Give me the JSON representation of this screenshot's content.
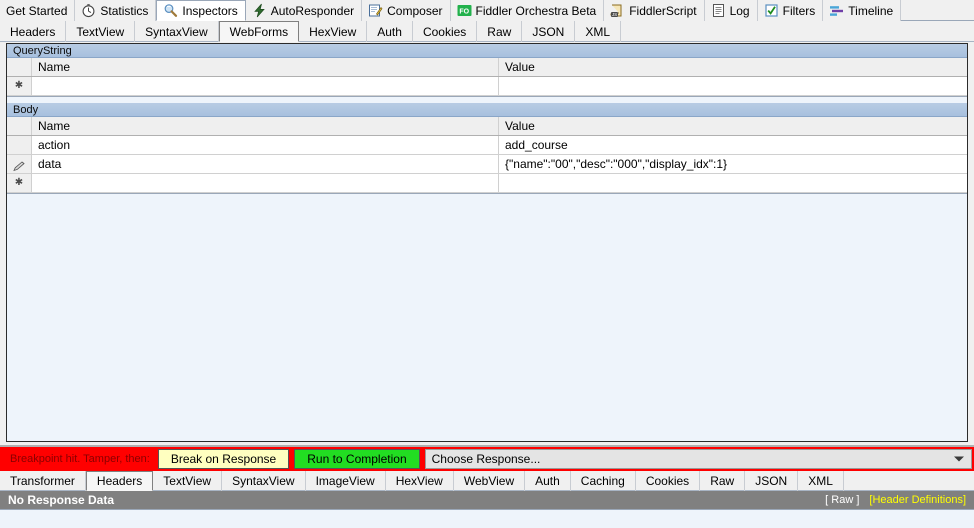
{
  "main_tabs": [
    {
      "label": "Get Started",
      "icon": "none",
      "selected": false
    },
    {
      "label": "Statistics",
      "icon": "stopwatch-icon",
      "selected": false
    },
    {
      "label": "Inspectors",
      "icon": "magnifier-icon",
      "selected": true
    },
    {
      "label": "AutoResponder",
      "icon": "lightning-icon",
      "selected": false
    },
    {
      "label": "Composer",
      "icon": "pencil-note-icon",
      "selected": false
    },
    {
      "label": "Fiddler Orchestra Beta",
      "icon": "fo-badge-icon",
      "selected": false
    },
    {
      "label": "FiddlerScript",
      "icon": "script-icon",
      "selected": false
    },
    {
      "label": "Log",
      "icon": "log-icon",
      "selected": false
    },
    {
      "label": "Filters",
      "icon": "checkbox-icon",
      "selected": false
    },
    {
      "label": "Timeline",
      "icon": "timeline-icon",
      "selected": false
    }
  ],
  "sub_tabs": [
    {
      "label": "Headers",
      "selected": false
    },
    {
      "label": "TextView",
      "selected": false
    },
    {
      "label": "SyntaxView",
      "selected": false
    },
    {
      "label": "WebForms",
      "selected": true
    },
    {
      "label": "HexView",
      "selected": false
    },
    {
      "label": "Auth",
      "selected": false
    },
    {
      "label": "Cookies",
      "selected": false
    },
    {
      "label": "Raw",
      "selected": false
    },
    {
      "label": "JSON",
      "selected": false
    },
    {
      "label": "XML",
      "selected": false
    }
  ],
  "webforms": {
    "querystring": {
      "section_label": "QueryString",
      "columns": {
        "name": "Name",
        "value": "Value"
      },
      "rows": [
        {
          "marker": "asterisk",
          "name": "",
          "value": ""
        }
      ]
    },
    "body": {
      "section_label": "Body",
      "columns": {
        "name": "Name",
        "value": "Value"
      },
      "rows": [
        {
          "marker": "",
          "name": "action",
          "value": "add_course"
        },
        {
          "marker": "pencil",
          "name": "data",
          "value": "{\"name\":\"00\",\"desc\":\"000\",\"display_idx\":1}"
        },
        {
          "marker": "asterisk",
          "name": "",
          "value": ""
        }
      ]
    }
  },
  "breakpoint": {
    "message": "Breakpoint hit. Tamper, then:",
    "break_on_response_label": "Break on Response",
    "run_to_completion_label": "Run to Completion",
    "choose_response_value": "Choose Response...",
    "bar_color": "#ff0000",
    "break_btn_color": "#ffffc0",
    "run_btn_color": "#22dd22"
  },
  "response_tabs": [
    {
      "label": "Transformer",
      "selected": false
    },
    {
      "label": "Headers",
      "selected": true
    },
    {
      "label": "TextView",
      "selected": false
    },
    {
      "label": "SyntaxView",
      "selected": false
    },
    {
      "label": "ImageView",
      "selected": false
    },
    {
      "label": "HexView",
      "selected": false
    },
    {
      "label": "WebView",
      "selected": false
    },
    {
      "label": "Auth",
      "selected": false
    },
    {
      "label": "Caching",
      "selected": false
    },
    {
      "label": "Cookies",
      "selected": false
    },
    {
      "label": "Raw",
      "selected": false
    },
    {
      "label": "JSON",
      "selected": false
    },
    {
      "label": "XML",
      "selected": false
    }
  ],
  "response_status": {
    "title": "No Response Data",
    "raw_link": "[ Raw ]",
    "header_definitions_link": "[Header Definitions]",
    "raw_color": "#ffffff",
    "header_definitions_color": "#ffff00",
    "bar_color": "#808080"
  }
}
